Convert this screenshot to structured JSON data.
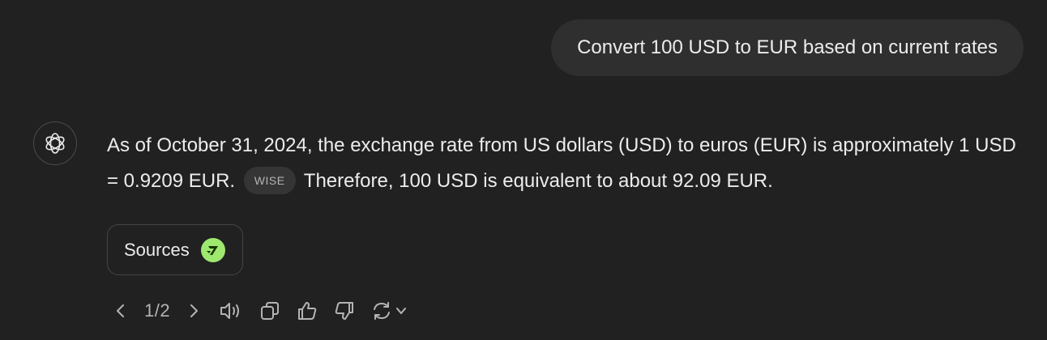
{
  "conversation": {
    "user_message": "Convert 100 USD to EUR based on current rates",
    "assistant": {
      "text_part1": "As of October 31, 2024, the exchange rate from US dollars (USD) to euros (EUR) is approximately 1 USD = 0.9209 EUR.",
      "citation_label": "WISE",
      "text_part2": "Therefore, 100 USD is equivalent to about 92.09 EUR.",
      "sources_label": "Sources"
    }
  },
  "actions": {
    "pager": "1/2",
    "icons": [
      "chevron-left-icon",
      "chevron-right-icon",
      "read-aloud-icon",
      "copy-icon",
      "thumbs-up-icon",
      "thumbs-down-icon",
      "regenerate-icon",
      "chevron-down-icon"
    ]
  },
  "colors": {
    "background": "#212121",
    "user_bubble": "#2f2f2f",
    "text": "#ececec",
    "muted": "#b4b4b4",
    "wise_green": "#9fe870"
  }
}
